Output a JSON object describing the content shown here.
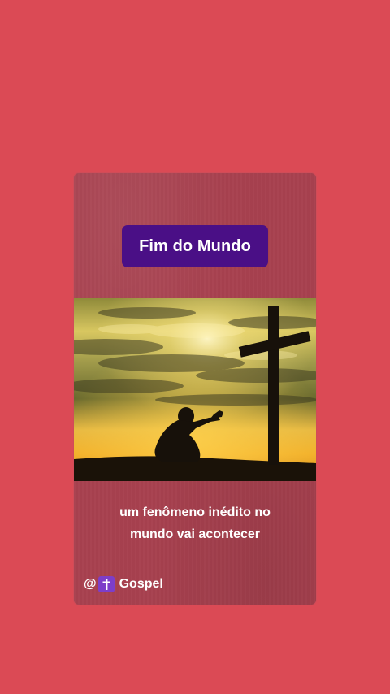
{
  "story": {
    "title": "Fim do Mundo",
    "image_alt": "silhouette of person kneeling in prayer before a cross at sunset",
    "caption_lines": [
      "um fenômeno inédito no",
      "mundo vai acontecer"
    ],
    "handle": {
      "prefix": "@",
      "icon": "latin-cross-emoji",
      "name": "Gospel"
    }
  },
  "colors": {
    "background": "#db4a55",
    "card": "#a8414f",
    "title_badge": "#4a0f86",
    "emoji_tile": "#7d3ec9"
  }
}
